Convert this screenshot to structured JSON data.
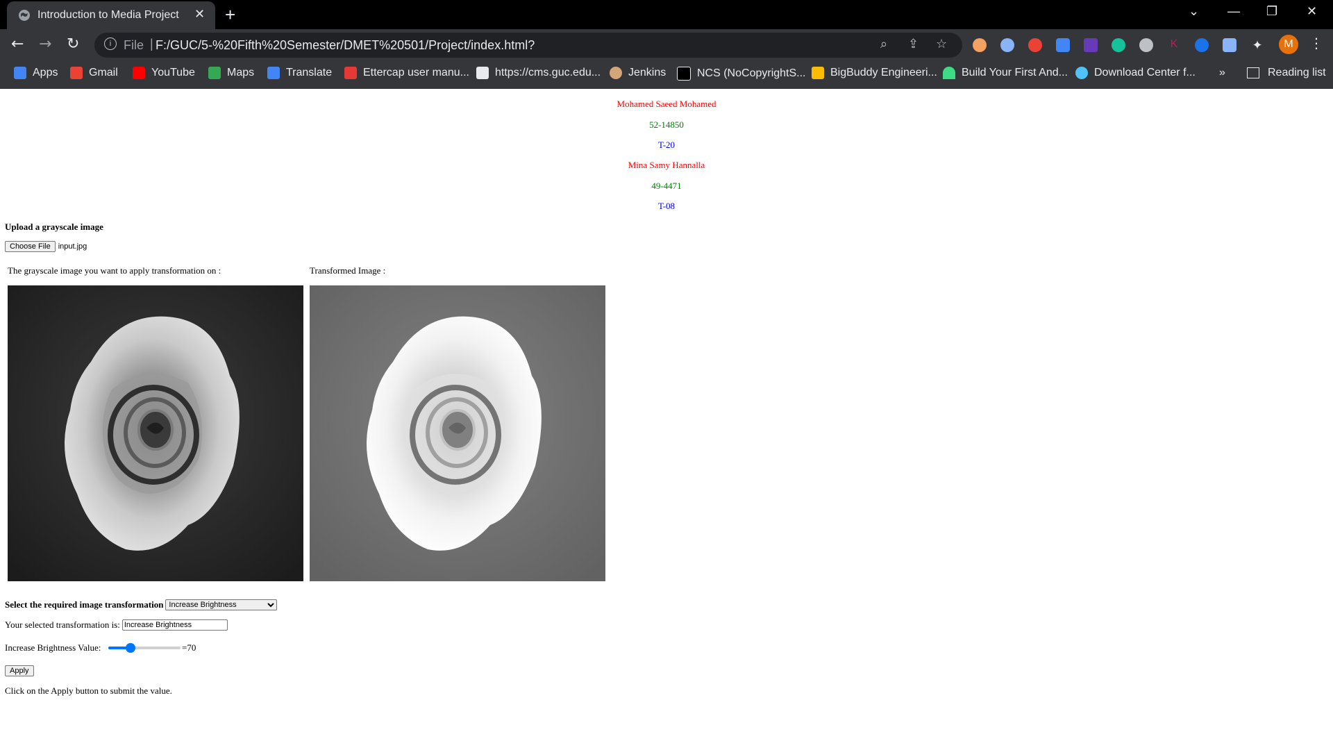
{
  "browser": {
    "tab_title": "Introduction to Media Project",
    "tab_close": "✕",
    "new_tab": "+",
    "url_scheme": "File",
    "url_separator": "|",
    "url": "F:/GUC/5-%20Fifth%20Semester/DMET%20501/Project/index.html?",
    "icons": [
      "back-icon",
      "forward-icon",
      "reload-icon",
      "info-icon",
      "zoom-icon",
      "share-icon",
      "star-icon",
      "extensions-icon",
      "menu-icon"
    ],
    "profile_initial": "M",
    "bookmarks": [
      {
        "label": "Apps",
        "color": "#4285f4"
      },
      {
        "label": "Gmail",
        "color": "#ea4335"
      },
      {
        "label": "YouTube",
        "color": "#ff0000"
      },
      {
        "label": "Maps",
        "color": "#34a853"
      },
      {
        "label": "Translate",
        "color": "#4285f4"
      },
      {
        "label": "Ettercap user manu...",
        "color": "#e53935"
      },
      {
        "label": "https://cms.guc.edu...",
        "color": "#e8eaed"
      },
      {
        "label": "Jenkins",
        "color": "#d5a57a"
      },
      {
        "label": "NCS (NoCopyrightS...",
        "color": "#000000"
      },
      {
        "label": "BigBuddy Engineeri...",
        "color": "#fbbc05"
      },
      {
        "label": "Build Your First And...",
        "color": "#3ddc84"
      },
      {
        "label": "Download Center f...",
        "color": "#4fc3f7"
      }
    ],
    "bookmarks_more": "»",
    "reading_list": "Reading list"
  },
  "page": {
    "students": [
      {
        "name": "Mohamed Saeed Mohamed",
        "id": "52-14850",
        "tutorial": "T-20"
      },
      {
        "name": "Mina Samy Hannalla",
        "id": "49-4471",
        "tutorial": "T-08"
      }
    ],
    "upload_heading": "Upload a grayscale image",
    "choose_file_label": "Choose File",
    "chosen_file": "input.jpg",
    "original_caption": "The grayscale image you want to apply transformation on :",
    "transformed_caption": "Transformed Image :",
    "select_label": "Select the required image transformation",
    "select_value": "Increase Brightness",
    "selected_label": "Your selected transformation is:",
    "selected_value": "Increase Brightness",
    "brightness_label": "Increase Brightness Value:",
    "brightness_value": 70,
    "brightness_readout": "=70",
    "apply_label": "Apply",
    "instruction": "Click on the Apply button to submit the value."
  }
}
